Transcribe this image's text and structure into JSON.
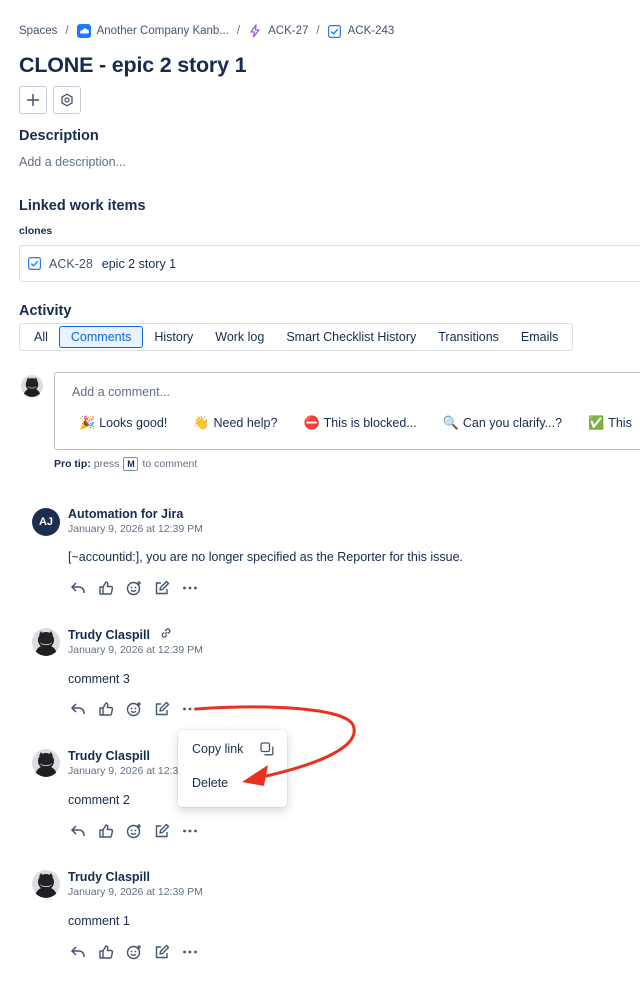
{
  "breadcrumb": {
    "spaces": "Spaces",
    "project": "Another Company Kanb...",
    "epic": "ACK-27",
    "issue": "ACK-243",
    "separator": "/"
  },
  "title": "CLONE - epic 2 story 1",
  "description": {
    "heading": "Description",
    "placeholder": "Add a description..."
  },
  "linked": {
    "heading": "Linked work items",
    "relation": "clones",
    "item": {
      "key": "ACK-28",
      "summary": "epic 2 story 1"
    }
  },
  "activity": {
    "heading": "Activity",
    "tabs": [
      "All",
      "Comments",
      "History",
      "Work log",
      "Smart Checklist History",
      "Transitions",
      "Emails"
    ],
    "active_tab": "Comments"
  },
  "composer": {
    "placeholder": "Add a comment...",
    "quick_replies": [
      {
        "emoji": "🎉",
        "label": "Looks good!"
      },
      {
        "emoji": "👋",
        "label": "Need help?"
      },
      {
        "emoji": "⛔",
        "label": "This is blocked..."
      },
      {
        "emoji": "🔍",
        "label": "Can you clarify...?"
      },
      {
        "emoji": "✅",
        "label": "This"
      }
    ],
    "protip_label": "Pro tip:",
    "protip_press": "press",
    "protip_key": "M",
    "protip_suffix": "to comment"
  },
  "comments": [
    {
      "author": "Automation for Jira",
      "initials": "AJ",
      "time": "January 9, 2026 at 12:39 PM",
      "body": "[~accountid:], you are no longer specified as the Reporter for this issue."
    },
    {
      "author": "Trudy Claspill",
      "time": "January 9, 2026 at 12:39 PM",
      "body": "comment 3"
    },
    {
      "author": "Trudy Claspill",
      "time": "January 9, 2026 at 12:3",
      "body": "comment 2"
    },
    {
      "author": "Trudy Claspill",
      "time": "January 9, 2026 at 12:39 PM",
      "body": "comment 1"
    }
  ],
  "menu": {
    "copy_link": "Copy link",
    "delete": "Delete"
  },
  "colors": {
    "accent": "#0c66e4",
    "annotation_arrow": "#e8321e",
    "text": "#172b4d"
  }
}
